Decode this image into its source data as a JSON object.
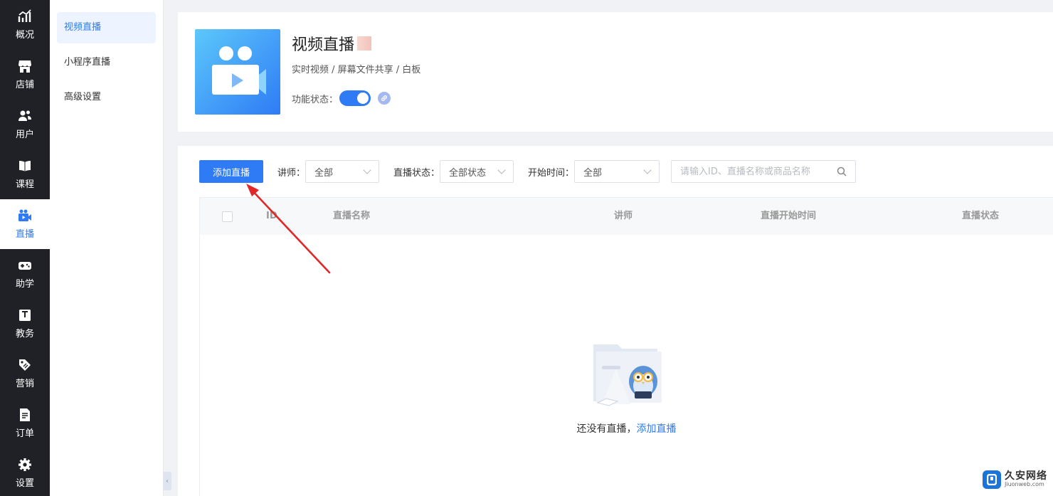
{
  "nav": {
    "items": [
      {
        "key": "overview",
        "label": "概况",
        "icon": "chart-line-icon"
      },
      {
        "key": "store",
        "label": "店铺",
        "icon": "store-icon"
      },
      {
        "key": "users",
        "label": "用户",
        "icon": "users-icon"
      },
      {
        "key": "courses",
        "label": "课程",
        "icon": "book-icon"
      },
      {
        "key": "live",
        "label": "直播",
        "icon": "video-camera-icon",
        "active": true
      },
      {
        "key": "assist",
        "label": "助学",
        "icon": "gamepad-icon"
      },
      {
        "key": "academic",
        "label": "教务",
        "icon": "notebook-icon"
      },
      {
        "key": "marketing",
        "label": "营销",
        "icon": "tag-icon"
      },
      {
        "key": "orders",
        "label": "订单",
        "icon": "document-icon"
      },
      {
        "key": "settings",
        "label": "设置",
        "icon": "gear-icon"
      }
    ]
  },
  "subnav": {
    "items": [
      {
        "label": "视频直播",
        "active": true
      },
      {
        "label": "小程序直播"
      },
      {
        "label": "高级设置"
      }
    ],
    "collapse_glyph": "‹"
  },
  "feature": {
    "title": "视频直播",
    "subtitle": "实时视频 / 屏幕文件共享 / 白板",
    "status_label": "功能状态：",
    "enabled": true
  },
  "toolbar": {
    "add_button": "添加直播",
    "lecturer_label": "讲师：",
    "lecturer_value": "全部",
    "status_label": "直播状态：",
    "status_value": "全部状态",
    "start_label": "开始时间：",
    "start_value": "全部",
    "search_placeholder": "请输入ID、直播名称或商品名称"
  },
  "table": {
    "columns": [
      "ID",
      "直播名称",
      "讲师",
      "直播开始时间",
      "直播状态"
    ],
    "rows": []
  },
  "empty": {
    "text": "还没有直播，",
    "link": "添加直播"
  },
  "watermark": {
    "cn": "久安网络",
    "en": "Jiuonweb.com"
  },
  "colors": {
    "primary": "#2f7bf5",
    "nav_bg": "#1f2126",
    "annotation": "#e02828"
  }
}
